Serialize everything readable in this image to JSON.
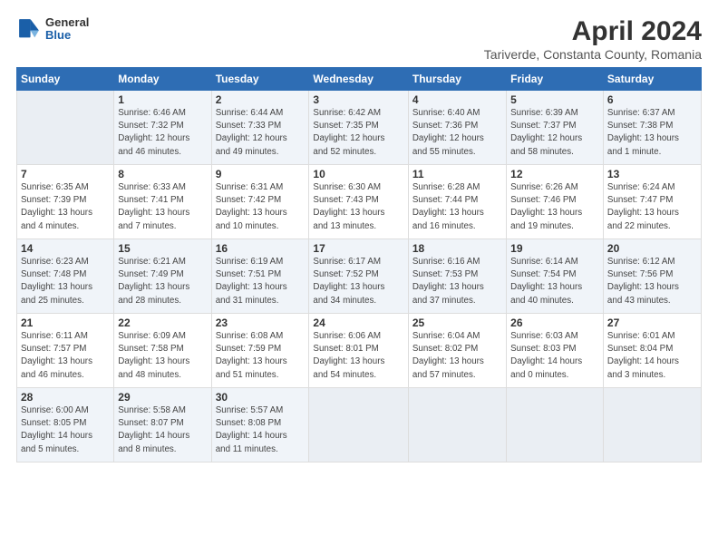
{
  "header": {
    "logo_general": "General",
    "logo_blue": "Blue",
    "month": "April 2024",
    "location": "Tariverde, Constanta County, Romania"
  },
  "columns": [
    "Sunday",
    "Monday",
    "Tuesday",
    "Wednesday",
    "Thursday",
    "Friday",
    "Saturday"
  ],
  "rows": [
    [
      {
        "day": "",
        "info": ""
      },
      {
        "day": "1",
        "info": "Sunrise: 6:46 AM\nSunset: 7:32 PM\nDaylight: 12 hours\nand 46 minutes."
      },
      {
        "day": "2",
        "info": "Sunrise: 6:44 AM\nSunset: 7:33 PM\nDaylight: 12 hours\nand 49 minutes."
      },
      {
        "day": "3",
        "info": "Sunrise: 6:42 AM\nSunset: 7:35 PM\nDaylight: 12 hours\nand 52 minutes."
      },
      {
        "day": "4",
        "info": "Sunrise: 6:40 AM\nSunset: 7:36 PM\nDaylight: 12 hours\nand 55 minutes."
      },
      {
        "day": "5",
        "info": "Sunrise: 6:39 AM\nSunset: 7:37 PM\nDaylight: 12 hours\nand 58 minutes."
      },
      {
        "day": "6",
        "info": "Sunrise: 6:37 AM\nSunset: 7:38 PM\nDaylight: 13 hours\nand 1 minute."
      }
    ],
    [
      {
        "day": "7",
        "info": "Sunrise: 6:35 AM\nSunset: 7:39 PM\nDaylight: 13 hours\nand 4 minutes."
      },
      {
        "day": "8",
        "info": "Sunrise: 6:33 AM\nSunset: 7:41 PM\nDaylight: 13 hours\nand 7 minutes."
      },
      {
        "day": "9",
        "info": "Sunrise: 6:31 AM\nSunset: 7:42 PM\nDaylight: 13 hours\nand 10 minutes."
      },
      {
        "day": "10",
        "info": "Sunrise: 6:30 AM\nSunset: 7:43 PM\nDaylight: 13 hours\nand 13 minutes."
      },
      {
        "day": "11",
        "info": "Sunrise: 6:28 AM\nSunset: 7:44 PM\nDaylight: 13 hours\nand 16 minutes."
      },
      {
        "day": "12",
        "info": "Sunrise: 6:26 AM\nSunset: 7:46 PM\nDaylight: 13 hours\nand 19 minutes."
      },
      {
        "day": "13",
        "info": "Sunrise: 6:24 AM\nSunset: 7:47 PM\nDaylight: 13 hours\nand 22 minutes."
      }
    ],
    [
      {
        "day": "14",
        "info": "Sunrise: 6:23 AM\nSunset: 7:48 PM\nDaylight: 13 hours\nand 25 minutes."
      },
      {
        "day": "15",
        "info": "Sunrise: 6:21 AM\nSunset: 7:49 PM\nDaylight: 13 hours\nand 28 minutes."
      },
      {
        "day": "16",
        "info": "Sunrise: 6:19 AM\nSunset: 7:51 PM\nDaylight: 13 hours\nand 31 minutes."
      },
      {
        "day": "17",
        "info": "Sunrise: 6:17 AM\nSunset: 7:52 PM\nDaylight: 13 hours\nand 34 minutes."
      },
      {
        "day": "18",
        "info": "Sunrise: 6:16 AM\nSunset: 7:53 PM\nDaylight: 13 hours\nand 37 minutes."
      },
      {
        "day": "19",
        "info": "Sunrise: 6:14 AM\nSunset: 7:54 PM\nDaylight: 13 hours\nand 40 minutes."
      },
      {
        "day": "20",
        "info": "Sunrise: 6:12 AM\nSunset: 7:56 PM\nDaylight: 13 hours\nand 43 minutes."
      }
    ],
    [
      {
        "day": "21",
        "info": "Sunrise: 6:11 AM\nSunset: 7:57 PM\nDaylight: 13 hours\nand 46 minutes."
      },
      {
        "day": "22",
        "info": "Sunrise: 6:09 AM\nSunset: 7:58 PM\nDaylight: 13 hours\nand 48 minutes."
      },
      {
        "day": "23",
        "info": "Sunrise: 6:08 AM\nSunset: 7:59 PM\nDaylight: 13 hours\nand 51 minutes."
      },
      {
        "day": "24",
        "info": "Sunrise: 6:06 AM\nSunset: 8:01 PM\nDaylight: 13 hours\nand 54 minutes."
      },
      {
        "day": "25",
        "info": "Sunrise: 6:04 AM\nSunset: 8:02 PM\nDaylight: 13 hours\nand 57 minutes."
      },
      {
        "day": "26",
        "info": "Sunrise: 6:03 AM\nSunset: 8:03 PM\nDaylight: 14 hours\nand 0 minutes."
      },
      {
        "day": "27",
        "info": "Sunrise: 6:01 AM\nSunset: 8:04 PM\nDaylight: 14 hours\nand 3 minutes."
      }
    ],
    [
      {
        "day": "28",
        "info": "Sunrise: 6:00 AM\nSunset: 8:05 PM\nDaylight: 14 hours\nand 5 minutes."
      },
      {
        "day": "29",
        "info": "Sunrise: 5:58 AM\nSunset: 8:07 PM\nDaylight: 14 hours\nand 8 minutes."
      },
      {
        "day": "30",
        "info": "Sunrise: 5:57 AM\nSunset: 8:08 PM\nDaylight: 14 hours\nand 11 minutes."
      },
      {
        "day": "",
        "info": ""
      },
      {
        "day": "",
        "info": ""
      },
      {
        "day": "",
        "info": ""
      },
      {
        "day": "",
        "info": ""
      }
    ]
  ]
}
